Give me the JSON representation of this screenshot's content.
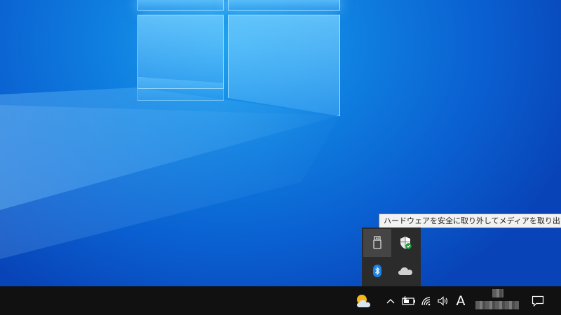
{
  "desktop": {
    "background_color": "#0a5fd0",
    "logo_color": "#78d2ff"
  },
  "tooltip": {
    "text": "ハードウェアを安全に取り外してメディアを取り出す"
  },
  "tray_flyout": {
    "items": [
      {
        "icon": "usb-drive-icon",
        "state": "hover"
      },
      {
        "icon": "windows-security-shield-icon"
      },
      {
        "icon": "bluetooth-icon"
      },
      {
        "icon": "onedrive-cloud-icon"
      }
    ]
  },
  "taskbar": {
    "background_color": "#111111",
    "weather_icon": "weather-partly-cloudy-icon",
    "show_hidden_icon": "chevron-up-icon",
    "battery_icon": "battery-icon",
    "network_icon": "wifi-icon",
    "volume_icon": "volume-icon",
    "ime_indicator": "A",
    "notification_icon": "notification-center-icon"
  }
}
